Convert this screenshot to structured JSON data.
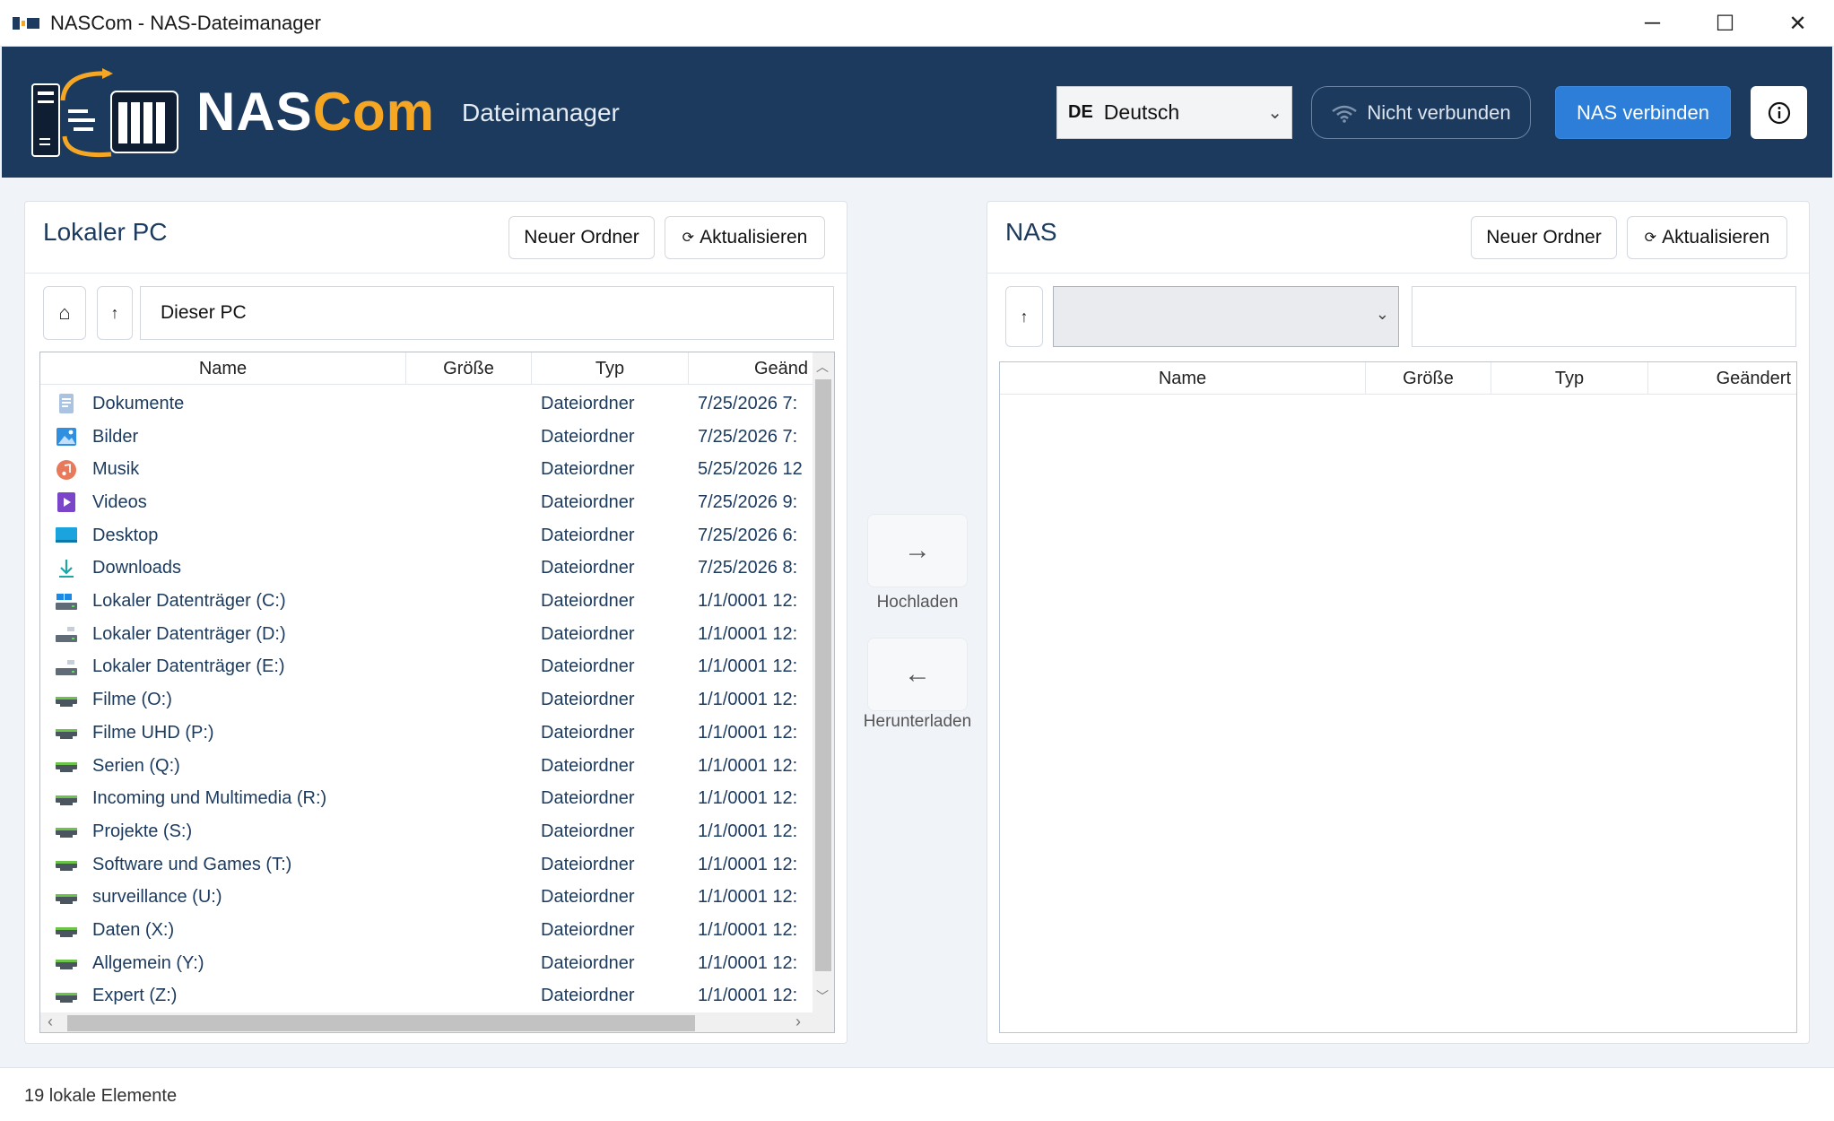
{
  "window": {
    "title": "NASCom - NAS-Dateimanager",
    "minimize": "─",
    "maximize": "☐",
    "close": "✕"
  },
  "header": {
    "logo_part1": "NAS",
    "logo_part2": "Com",
    "subtitle": "Dateimanager",
    "language": {
      "code": "DE",
      "label": "Deutsch"
    },
    "connection_status": "Nicht verbunden",
    "connect_button": "NAS verbinden",
    "colors": {
      "header_bg": "#1b3a5e",
      "accent": "#f5a623",
      "primary_button": "#2d7ed8"
    }
  },
  "local_panel": {
    "title": "Lokaler PC",
    "new_folder": "Neuer Ordner",
    "refresh": "Aktualisieren",
    "home_icon": "⌂",
    "up_icon": "↑",
    "path": "Dieser PC",
    "columns": [
      "Name",
      "Größe",
      "Typ",
      "Geänd"
    ],
    "rows": [
      {
        "name": "Dokumente",
        "type": "Dateiordner",
        "date": "7/25/2026 7:",
        "icon": "documents-folder-icon"
      },
      {
        "name": "Bilder",
        "type": "Dateiordner",
        "date": "7/25/2026 7:",
        "icon": "pictures-folder-icon"
      },
      {
        "name": "Musik",
        "type": "Dateiordner",
        "date": "5/25/2026 12",
        "icon": "music-folder-icon"
      },
      {
        "name": "Videos",
        "type": "Dateiordner",
        "date": "7/25/2026 9:",
        "icon": "videos-folder-icon"
      },
      {
        "name": "Desktop",
        "type": "Dateiordner",
        "date": "7/25/2026 6:",
        "icon": "desktop-folder-icon"
      },
      {
        "name": "Downloads",
        "type": "Dateiordner",
        "date": "7/25/2026 8:",
        "icon": "downloads-folder-icon"
      },
      {
        "name": "Lokaler Datenträger (C:)",
        "type": "Dateiordner",
        "date": "1/1/0001 12:",
        "icon": "system-drive-icon"
      },
      {
        "name": "Lokaler Datenträger (D:)",
        "type": "Dateiordner",
        "date": "1/1/0001 12:",
        "icon": "local-drive-icon"
      },
      {
        "name": "Lokaler Datenträger (E:)",
        "type": "Dateiordner",
        "date": "1/1/0001 12:",
        "icon": "local-drive-icon"
      },
      {
        "name": "Filme (O:)",
        "type": "Dateiordner",
        "date": "1/1/0001 12:",
        "icon": "network-drive-icon"
      },
      {
        "name": "Filme UHD (P:)",
        "type": "Dateiordner",
        "date": "1/1/0001 12:",
        "icon": "network-drive-icon"
      },
      {
        "name": "Serien (Q:)",
        "type": "Dateiordner",
        "date": "1/1/0001 12:",
        "icon": "network-drive-icon"
      },
      {
        "name": "Incoming und Multimedia (R:)",
        "type": "Dateiordner",
        "date": "1/1/0001 12:",
        "icon": "network-drive-icon"
      },
      {
        "name": "Projekte (S:)",
        "type": "Dateiordner",
        "date": "1/1/0001 12:",
        "icon": "network-drive-icon"
      },
      {
        "name": "Software und Games (T:)",
        "type": "Dateiordner",
        "date": "1/1/0001 12:",
        "icon": "network-drive-icon"
      },
      {
        "name": "surveillance (U:)",
        "type": "Dateiordner",
        "date": "1/1/0001 12:",
        "icon": "network-drive-icon"
      },
      {
        "name": "Daten (X:)",
        "type": "Dateiordner",
        "date": "1/1/0001 12:",
        "icon": "network-drive-icon"
      },
      {
        "name": "Allgemein (Y:)",
        "type": "Dateiordner",
        "date": "1/1/0001 12:",
        "icon": "network-drive-icon"
      },
      {
        "name": "Expert (Z:)",
        "type": "Dateiordner",
        "date": "1/1/0001 12:",
        "icon": "network-drive-icon"
      }
    ]
  },
  "transfer": {
    "upload_icon": "→",
    "upload_label": "Hochladen",
    "download_icon": "←",
    "download_label": "Herunterladen"
  },
  "nas_panel": {
    "title": "NAS",
    "new_folder": "Neuer Ordner",
    "refresh": "Aktualisieren",
    "up_icon": "↑",
    "share_select": "",
    "path": "",
    "columns": [
      "Name",
      "Größe",
      "Typ",
      "Geändert"
    ]
  },
  "status": {
    "text": "19 lokale Elemente"
  }
}
